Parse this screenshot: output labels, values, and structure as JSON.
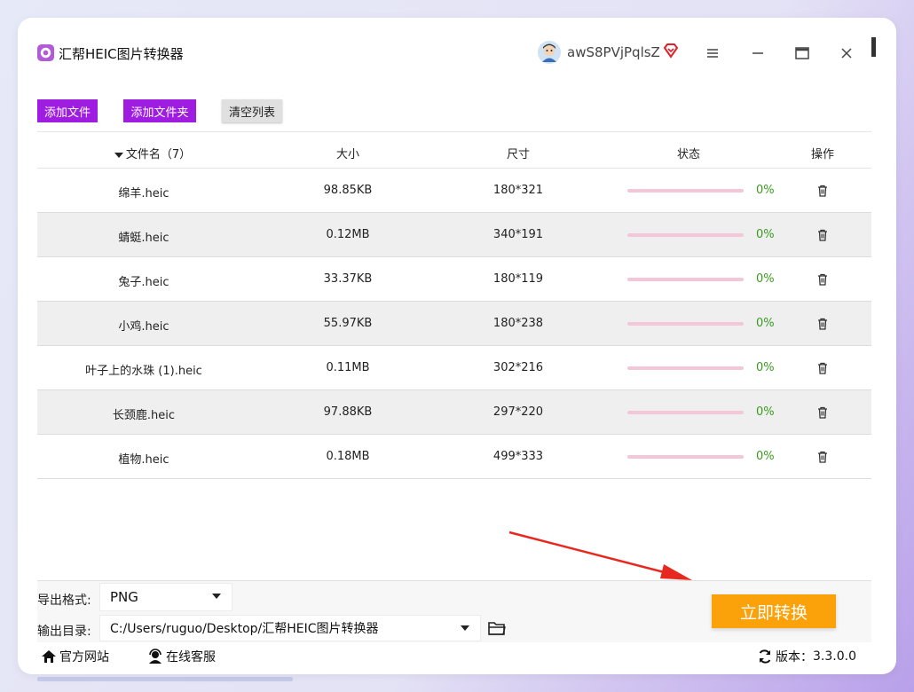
{
  "app": {
    "title": "汇帮HEIC图片转换器",
    "username": "awS8PVjPqlsZ",
    "accent_color": "#9f1de0",
    "convert_color": "#fba20b"
  },
  "toolbar": {
    "add_file": "添加文件",
    "add_folder": "添加文件夹",
    "clear_list": "清空列表"
  },
  "table": {
    "headers": {
      "name": "文件名（7）",
      "size": "大小",
      "dimension": "尺寸",
      "status": "状态",
      "action": "操作"
    },
    "rows": [
      {
        "name": "绵羊.heic",
        "size": "98.85KB",
        "dimension": "180*321",
        "progress": "0%"
      },
      {
        "name": "蜻蜓.heic",
        "size": "0.12MB",
        "dimension": "340*191",
        "progress": "0%"
      },
      {
        "name": "兔子.heic",
        "size": "33.37KB",
        "dimension": "180*119",
        "progress": "0%"
      },
      {
        "name": "小鸡.heic",
        "size": "55.97KB",
        "dimension": "180*238",
        "progress": "0%"
      },
      {
        "name": "叶子上的水珠 (1).heic",
        "size": "0.11MB",
        "dimension": "302*216",
        "progress": "0%"
      },
      {
        "name": "长颈鹿.heic",
        "size": "97.88KB",
        "dimension": "297*220",
        "progress": "0%"
      },
      {
        "name": "植物.heic",
        "size": "0.18MB",
        "dimension": "499*333",
        "progress": "0%"
      }
    ]
  },
  "settings": {
    "format_label": "导出格式:",
    "format_value": "PNG",
    "output_label": "输出目录:",
    "output_value": "C:/Users/ruguo/Desktop/汇帮HEIC图片转换器"
  },
  "convert_button": "立即转换",
  "footer": {
    "website": "官方网站",
    "support": "在线客服",
    "version_label": "版本：",
    "version_value": "3.3.0.0"
  },
  "icons": {
    "logo": "app-logo-icon",
    "vip": "vip-diamond-icon",
    "menu": "menu-icon",
    "minimize": "minimize-icon",
    "maximize": "maximize-icon",
    "close": "close-icon",
    "trash": "trash-icon",
    "folder": "folder-icon",
    "home": "home-icon",
    "support": "headset-icon",
    "refresh": "refresh-icon"
  }
}
